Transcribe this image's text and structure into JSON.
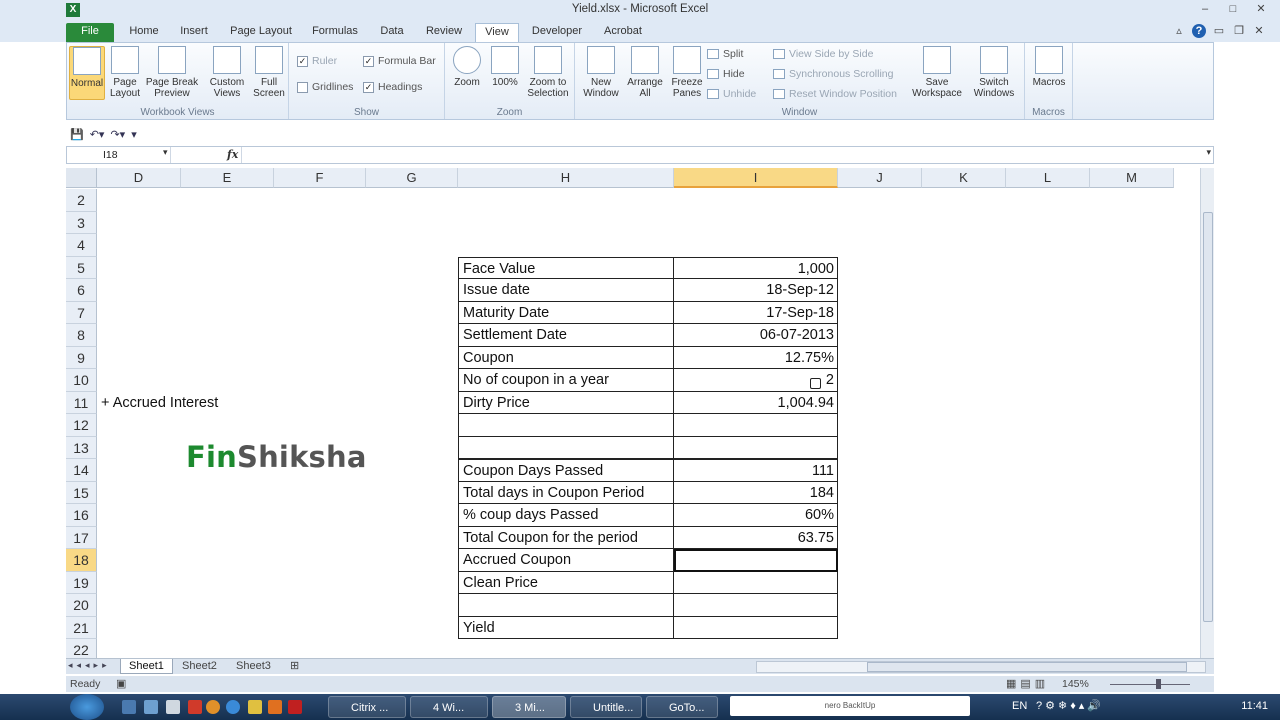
{
  "window": {
    "title": "Yield.xlsx - Microsoft Excel",
    "logo": "X",
    "controls": [
      "–",
      "□",
      "✕"
    ]
  },
  "ribbon_tabs": [
    "File",
    "Home",
    "Insert",
    "Page Layout",
    "Formulas",
    "Data",
    "Review",
    "View",
    "Developer",
    "Acrobat"
  ],
  "ribbon": {
    "workbook_views": {
      "label": "Workbook Views",
      "normal": "Normal",
      "page_layout": "Page Layout",
      "page_break": "Page Break Preview",
      "custom_views": "Custom Views",
      "full_screen": "Full Screen"
    },
    "show": {
      "label": "Show",
      "ruler": "Ruler",
      "formula_bar": "Formula Bar",
      "gridlines": "Gridlines",
      "headings": "Headings"
    },
    "zoom": {
      "label": "Zoom",
      "zoom": "Zoom",
      "hundred": "100%",
      "zoom_selection": "Zoom to Selection"
    },
    "window": {
      "label": "Window",
      "new_window": "New Window",
      "arrange_all": "Arrange All",
      "freeze_panes": "Freeze Panes",
      "split": "Split",
      "hide": "Hide",
      "unhide": "Unhide",
      "side_by_side": "View Side by Side",
      "sync_scroll": "Synchronous Scrolling",
      "reset_position": "Reset Window Position",
      "save_workspace": "Save Workspace",
      "switch_windows": "Switch Windows"
    },
    "macros": {
      "label": "Macros",
      "macros": "Macros"
    }
  },
  "formula_bar": {
    "name_box": "I18",
    "fx": "fx",
    "value": ""
  },
  "columns": [
    "D",
    "E",
    "F",
    "G",
    "H",
    "I",
    "J",
    "K",
    "L",
    "M"
  ],
  "rows": [
    "2",
    "3",
    "4",
    "5",
    "6",
    "7",
    "8",
    "9",
    "10",
    "11",
    "12",
    "13",
    "14",
    "15",
    "16",
    "17",
    "18",
    "19",
    "20",
    "21",
    "22"
  ],
  "note_cell": "+ Accrued Interest",
  "brand": {
    "part1": "Fin",
    "part2": "Shiksha"
  },
  "table": [
    {
      "label": "Face Value",
      "value": "1,000"
    },
    {
      "label": "Issue date",
      "value": "18-Sep-12"
    },
    {
      "label": "Maturity Date",
      "value": "17-Sep-18"
    },
    {
      "label": "Settlement Date",
      "value": "06-07-2013"
    },
    {
      "label": "Coupon",
      "value": "12.75%"
    },
    {
      "label": "No of coupon in a year",
      "value": "2"
    },
    {
      "label": "Dirty Price",
      "value": "1,004.94"
    },
    {
      "label": "",
      "value": ""
    },
    {
      "label": "",
      "value": ""
    },
    {
      "label": "Coupon Days Passed",
      "value": "111"
    },
    {
      "label": "Total days in Coupon Period",
      "value": "184"
    },
    {
      "label": "% coup days Passed",
      "value": "60%"
    },
    {
      "label": "Total Coupon for the period",
      "value": "63.75"
    },
    {
      "label": "Accrued Coupon",
      "value": ""
    },
    {
      "label": "Clean Price",
      "value": ""
    },
    {
      "label": "",
      "value": ""
    },
    {
      "label": "Yield",
      "value": ""
    }
  ],
  "sheets": [
    "Sheet1",
    "Sheet2",
    "Sheet3"
  ],
  "status": {
    "mode": "Ready",
    "zoom": "145%"
  },
  "taskbar": {
    "tasks": [
      "Citrix ...",
      "4 Wi...",
      "3 Mi...",
      "Untitle...",
      "GoTo..."
    ],
    "box_text": "nero BackItUp",
    "lang": "EN",
    "clock": "11:41"
  },
  "colors": {
    "accent": "#2a8a3a",
    "selected_header": "#f9d986",
    "brand_green": "#1d8a2f"
  }
}
